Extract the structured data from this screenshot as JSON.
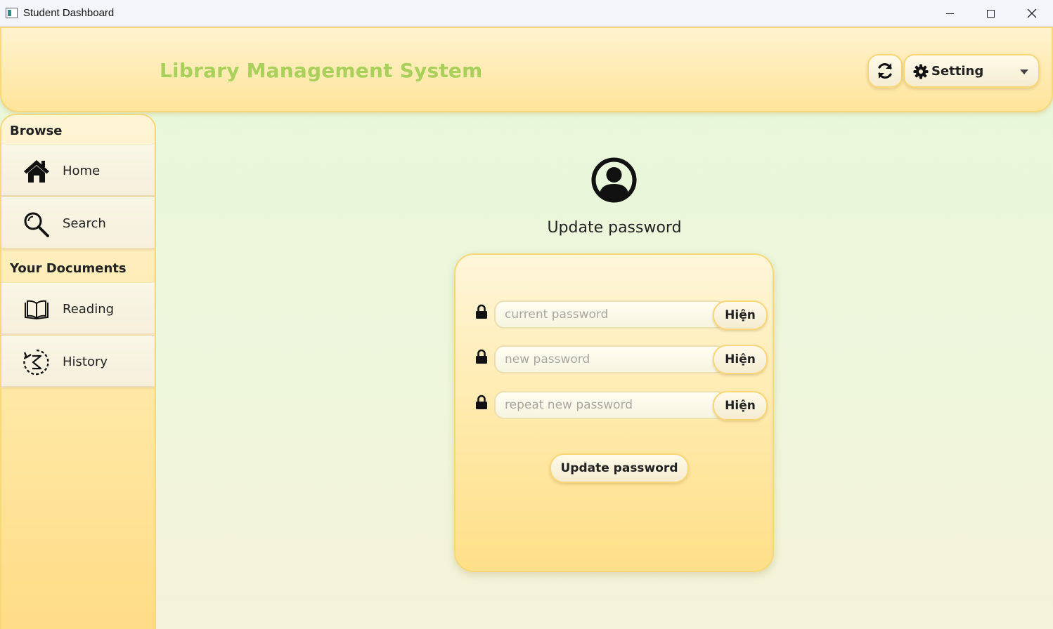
{
  "window": {
    "title": "Student Dashboard"
  },
  "header": {
    "app_name": "Library Management System",
    "setting_label": "Setting"
  },
  "sidebar": {
    "sections": [
      {
        "label": "Browse",
        "items": [
          {
            "label": "Home",
            "icon": "home-icon"
          },
          {
            "label": "Search",
            "icon": "search-icon"
          }
        ]
      },
      {
        "label": "Your Documents",
        "items": [
          {
            "label": "Reading",
            "icon": "book-icon"
          },
          {
            "label": "History",
            "icon": "history-icon"
          }
        ]
      }
    ]
  },
  "form": {
    "title": "Update password",
    "fields": [
      {
        "placeholder": "current password",
        "show_label": "Hiện"
      },
      {
        "placeholder": "new password",
        "show_label": "Hiện"
      },
      {
        "placeholder": "repeat new password",
        "show_label": "Hiện"
      }
    ],
    "submit_label": "Update password"
  },
  "colors": {
    "brand_title": "#a8d05a",
    "panel_border": "#f8d778",
    "panel_fill": "#ffe49a",
    "background": "#e6f7d8"
  }
}
